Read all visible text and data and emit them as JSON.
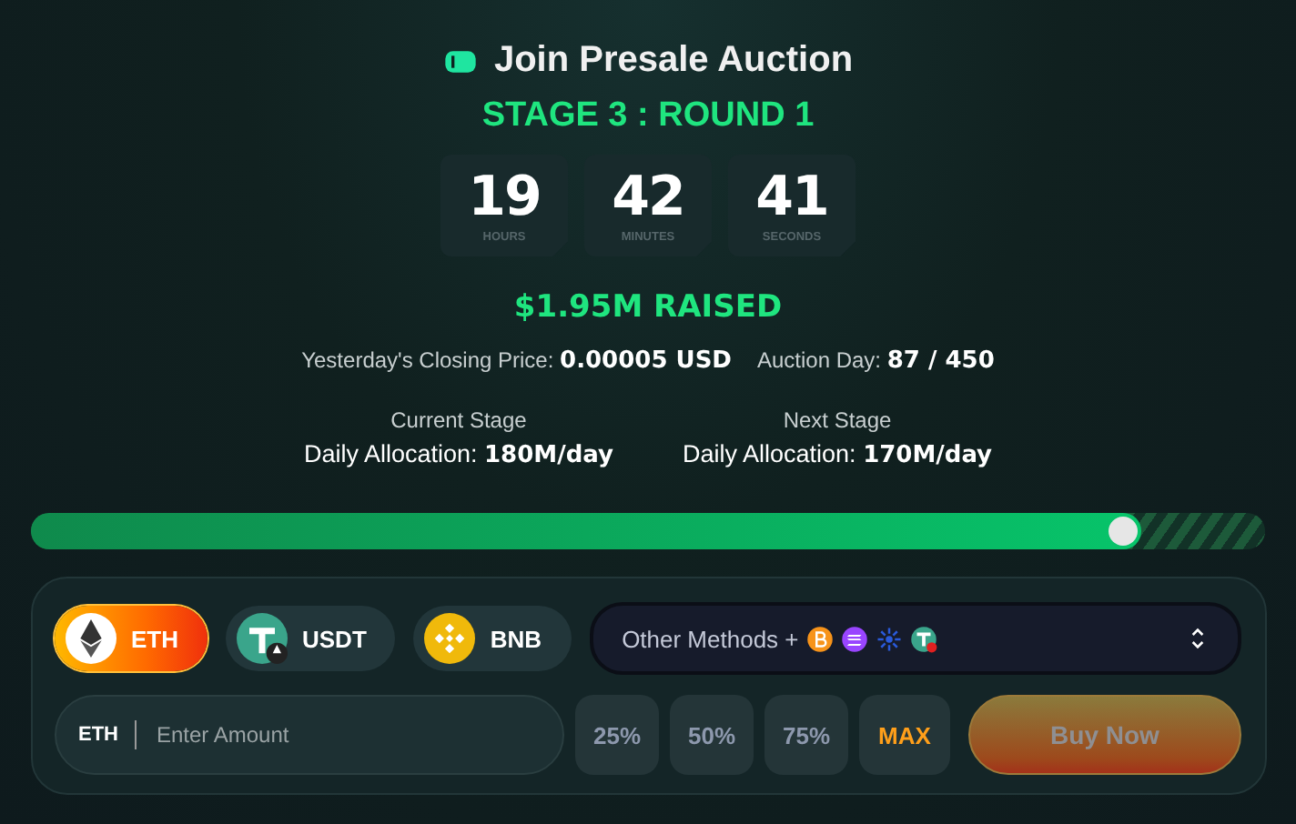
{
  "title": "Join Presale Auction",
  "stage": "STAGE 3 : ROUND 1",
  "countdown": [
    {
      "value": "19",
      "unit": "HOURS"
    },
    {
      "value": "42",
      "unit": "MINUTES"
    },
    {
      "value": "41",
      "unit": "SECONDS"
    }
  ],
  "raised": "$1.95M RAISED",
  "stats": [
    {
      "label": "Yesterday's Closing Price:",
      "value": "0.00005 USD"
    },
    {
      "label": "Auction Day:",
      "value": "87 / 450"
    }
  ],
  "stages": [
    {
      "caption": "Current Stage",
      "label": "Daily Allocation:",
      "value": "180M/day"
    },
    {
      "caption": "Next Stage",
      "label": "Daily Allocation:",
      "value": "170M/day"
    }
  ],
  "progress": {
    "level": 0.9
  },
  "currencies": [
    {
      "label": "ETH",
      "kind": "eth",
      "selected": true
    },
    {
      "label": "USDT",
      "kind": "usdt",
      "selected": false
    },
    {
      "label": "BNB",
      "kind": "bnb",
      "selected": false
    }
  ],
  "other_methods": {
    "label": "Other Methods +"
  },
  "amount": {
    "currency": "ETH",
    "placeholder": "Enter Amount"
  },
  "shortcuts": [
    {
      "label": "25%",
      "kind": "percent"
    },
    {
      "label": "50%",
      "kind": "percent"
    },
    {
      "label": "75%",
      "kind": "percent"
    },
    {
      "label": "MAX",
      "kind": "max"
    }
  ],
  "buy_button": {
    "label": "Buy Now",
    "disabled": true
  }
}
